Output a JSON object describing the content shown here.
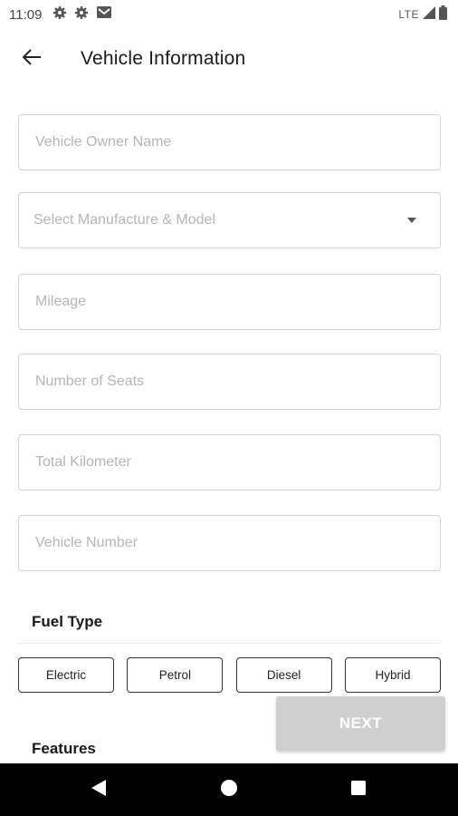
{
  "status_bar": {
    "time": "11:09",
    "network": "LTE",
    "left_icons": [
      "gear-icon",
      "gear-icon",
      "gmail-icon"
    ],
    "right_icons": [
      "signal-icon",
      "battery-icon"
    ]
  },
  "header": {
    "title": "Vehicle Information",
    "back_icon": "arrow-left-icon"
  },
  "form": {
    "owner_name_placeholder": "Vehicle Owner Name",
    "manufacture_model_placeholder": "Select Manufacture & Model",
    "mileage_placeholder": "Mileage",
    "seats_placeholder": "Number of Seats",
    "kilometer_placeholder": "Total Kilometer",
    "vehicle_number_placeholder": "Vehicle Number"
  },
  "fuel_type": {
    "title": "Fuel Type",
    "options": [
      "Electric",
      "Petrol",
      "Diesel",
      "Hybrid"
    ]
  },
  "features": {
    "title": "Features"
  },
  "actions": {
    "next_label": "NEXT"
  },
  "colors": {
    "next_button_bg": "#cfcfcf",
    "field_border": "#d2d2d2",
    "chip_border": "#333333",
    "nav_bar_bg": "#000000"
  },
  "nav_bar": {
    "icons": [
      "back-triangle-icon",
      "home-circle-icon",
      "recents-square-icon"
    ]
  }
}
